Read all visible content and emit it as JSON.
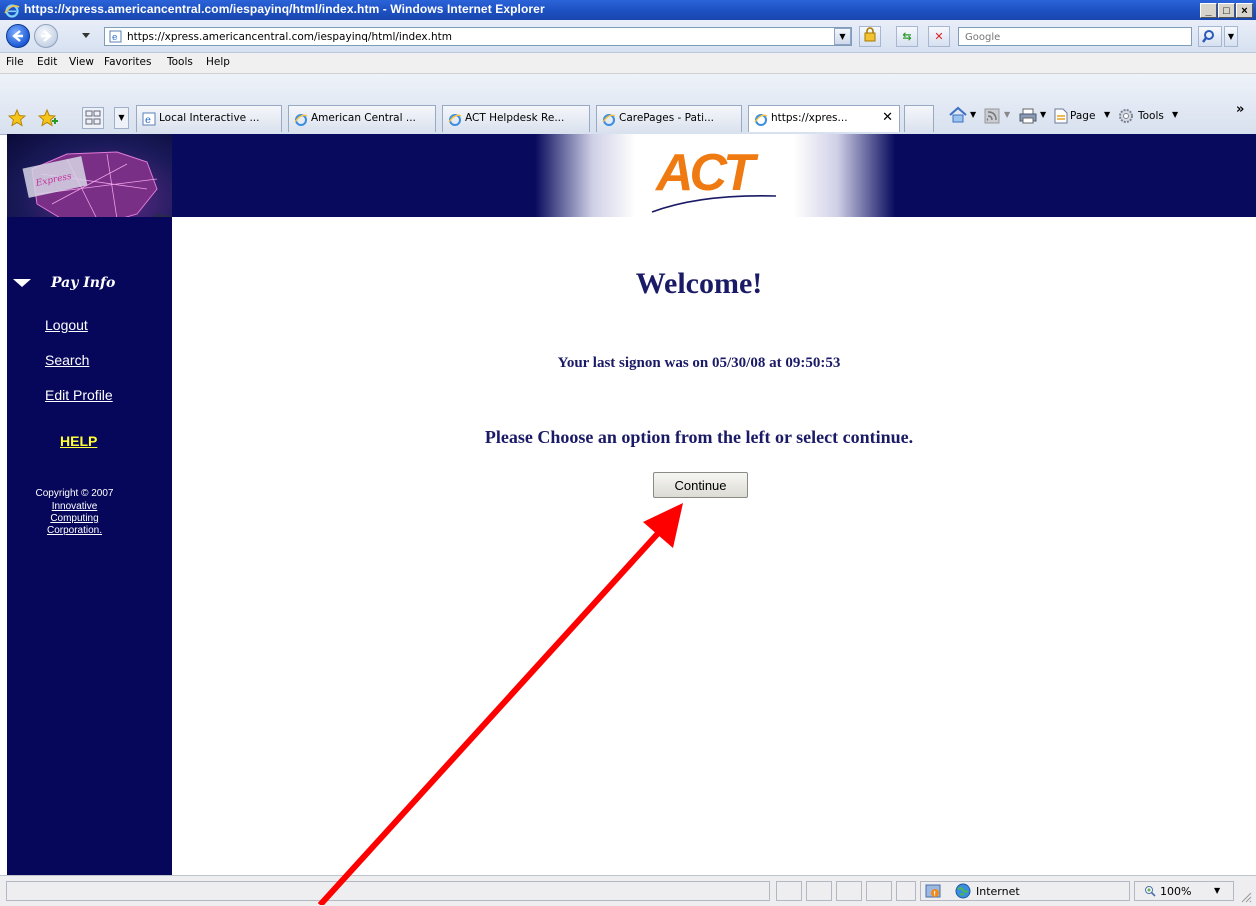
{
  "window": {
    "title": "https://xpress.americancentral.com/iespayinq/html/index.htm - Windows Internet Explorer",
    "controls": [
      "_",
      "□",
      "×"
    ]
  },
  "addressbar": {
    "url": "https://xpress.americancentral.com/iespayinq/html/index.htm",
    "search_placeholder": "Google"
  },
  "menu": [
    "File",
    "Edit",
    "View",
    "Favorites",
    "Tools",
    "Help"
  ],
  "tabs": [
    {
      "label": "Local Interactive ...",
      "active": false
    },
    {
      "label": "American Central ...",
      "active": false
    },
    {
      "label": "ACT Helpdesk Re...",
      "active": false
    },
    {
      "label": "CarePages - Pati...",
      "active": false
    },
    {
      "label": "https://xpres...",
      "active": true
    }
  ],
  "command_bar": {
    "page": "Page",
    "tools": "Tools",
    "more": "»"
  },
  "banner": {
    "logo_text": "ACT"
  },
  "sidebar": {
    "section": "Pay Info",
    "links": [
      "Logout",
      "Search",
      "Edit Profile"
    ],
    "help": "HELP",
    "copyright": "Copyright © 2007",
    "company": [
      "Innovative",
      "Computing",
      "Corporation."
    ]
  },
  "main": {
    "welcome": "Welcome!",
    "last_signon": "Your last signon was on 05/30/08 at 09:50:53",
    "instruction": "Please Choose an option from the left or select continue.",
    "continue_label": "Continue"
  },
  "statusbar": {
    "zone": "Internet",
    "zoom": "100%"
  },
  "colors": {
    "sidebar_bg": "#06075b",
    "heading": "#1a1a66",
    "help": "#ffff33",
    "annotation_arrow": "#ff0000"
  }
}
